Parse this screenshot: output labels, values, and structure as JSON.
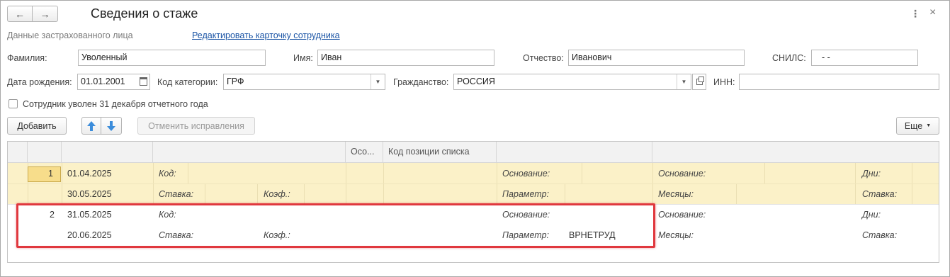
{
  "window": {
    "title": "Сведения о стаже",
    "more_icon": "more-vertical-icon",
    "close_icon": "close-icon"
  },
  "header": {
    "section_label": "Данные застрахованного лица",
    "edit_link": "Редактировать карточку сотрудника"
  },
  "form": {
    "surname_label": "Фамилия:",
    "surname": "Уволенный",
    "name_label": "Имя:",
    "name": "Иван",
    "patronymic_label": "Отчество:",
    "patronymic": "Иванович",
    "snils_label": "СНИЛС:",
    "snils": "-  -",
    "birth_label": "Дата рождения:",
    "birth_date": "01.01.2001",
    "category_label": "Код категории:",
    "category": "ГРФ",
    "citizenship_label": "Гражданство:",
    "citizenship": "РОССИЯ",
    "inn_label": "ИНН:",
    "inn": "",
    "dismissed_label": "Сотрудник уволен 31 декабря отчетного года",
    "dismissed_checked": false
  },
  "toolbar": {
    "add_label": "Добавить",
    "cancel_fixes_label": "Отменить исправления",
    "more_label": "Еще"
  },
  "table": {
    "headers": [
      "",
      "",
      "",
      "Осо...",
      "Код позиции списка",
      "",
      ""
    ],
    "rows": [
      {
        "num": "1",
        "date_start": "01.04.2025",
        "date_end": "30.05.2025",
        "kod_label": "Код:",
        "stavka_label": "Ставка:",
        "koef_label": "Коэф.:",
        "osnovanie_label": "Основание:",
        "parametr_label": "Параметр:",
        "parametr_value": "",
        "osnovanie2_label": "Основание:",
        "mesyacy_label": "Месяцы:",
        "dni_label": "Дни:",
        "stavka2_label": "Ставка:"
      },
      {
        "num": "2",
        "date_start": "31.05.2025",
        "date_end": "20.06.2025",
        "kod_label": "Код:",
        "stavka_label": "Ставка:",
        "koef_label": "Коэф.:",
        "osnovanie_label": "Основание:",
        "parametr_label": "Параметр:",
        "parametr_value": "ВРНЕТРУД",
        "osnovanie2_label": "Основание:",
        "mesyacy_label": "Месяцы:",
        "dni_label": "Дни:",
        "stavka2_label": "Ставка:"
      }
    ]
  },
  "colors": {
    "selected_row": "#fbf1c8",
    "highlight_border": "#e0383e",
    "link": "#1a54a5"
  }
}
